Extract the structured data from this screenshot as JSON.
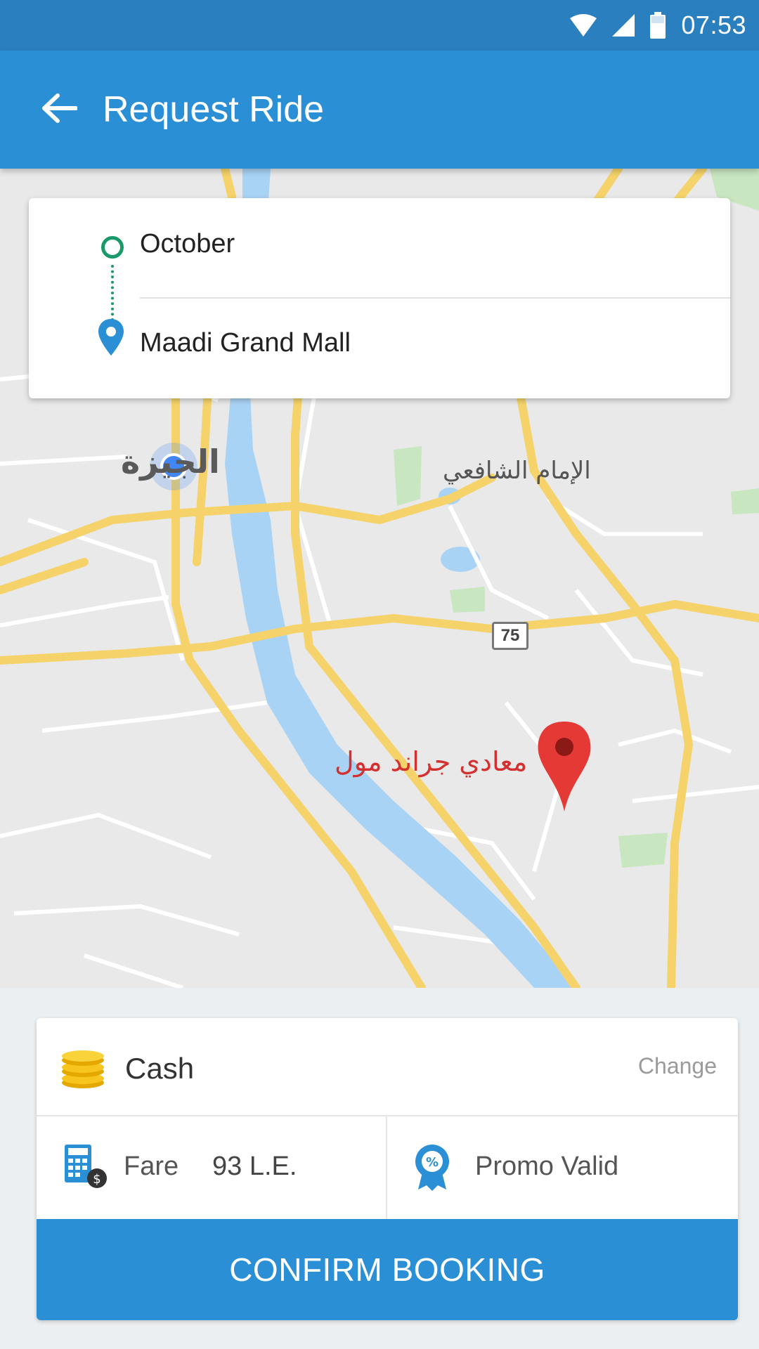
{
  "status_bar": {
    "time": "07:53"
  },
  "app_bar": {
    "title": "Request Ride",
    "back_icon": "arrow-left-icon"
  },
  "route": {
    "from": "October",
    "to": "Maadi Grand Mall",
    "origin_color": "#1a9a6a",
    "destination_color": "#2a8fd5"
  },
  "map": {
    "labels": {
      "giza": "الجيزة",
      "imam_shafei": "الإمام الشافعي",
      "maadi_grand_mall": "معادي جراند مول",
      "highway_number": "75"
    }
  },
  "booking": {
    "payment_method": "Cash",
    "change_label": "Change",
    "fare_label": "Fare",
    "fare_value": "93 L.E.",
    "promo_label": "Promo Valid",
    "confirm_label": "CONFIRM BOOKING"
  },
  "colors": {
    "primary": "#2a8fd5",
    "status_bar": "#2a7fbf",
    "marker": "#e53935"
  }
}
